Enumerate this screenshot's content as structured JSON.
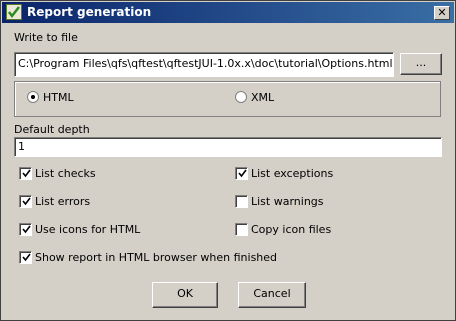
{
  "window": {
    "title": "Report generation",
    "close_glyph": "✕"
  },
  "write_to_file": {
    "label": "Write to file",
    "value": "C:\\Program Files\\qfs\\qftest\\qftestJUI-1.0x.x\\doc\\tutorial\\Options.html",
    "browse_label": "..."
  },
  "format": {
    "options": [
      {
        "label": "HTML",
        "selected": true
      },
      {
        "label": "XML",
        "selected": false
      }
    ]
  },
  "default_depth": {
    "label": "Default depth",
    "value": "1"
  },
  "options": {
    "list_checks": {
      "label": "List checks",
      "checked": true
    },
    "list_exceptions": {
      "label": "List exceptions",
      "checked": true
    },
    "list_errors": {
      "label": "List errors",
      "checked": true
    },
    "list_warnings": {
      "label": "List warnings",
      "checked": false
    },
    "use_icons": {
      "label": "Use icons for HTML",
      "checked": true
    },
    "copy_icons": {
      "label": "Copy icon files",
      "checked": false
    },
    "show_report": {
      "label": "Show report in HTML browser when finished",
      "checked": true
    }
  },
  "buttons": {
    "ok": "OK",
    "cancel": "Cancel"
  }
}
